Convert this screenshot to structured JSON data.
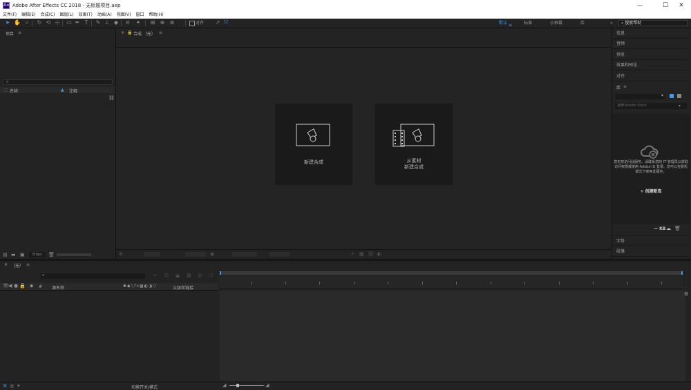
{
  "window": {
    "logo": "Ae",
    "title": "Adobe After Effects CC 2018 - 无标题项目.aep",
    "minimize": "—",
    "maximize": "☐",
    "close": "✕"
  },
  "menu": [
    "文件(F)",
    "编辑(E)",
    "合成(C)",
    "图层(L)",
    "效果(T)",
    "动画(A)",
    "视图(V)",
    "窗口",
    "帮助(H)"
  ],
  "toolbar": {
    "align_checkbox_label": "对齐",
    "workspaces": [
      "默认",
      "标准",
      "小屏幕",
      "库"
    ],
    "workspace_more": "»",
    "search_help": "搜索帮助"
  },
  "project_panel": {
    "title": "项目",
    "menu_icon": "≡",
    "search_icon": "search-icon",
    "col_name": "名称",
    "col_comment": "注释",
    "bpc": "8 bpc"
  },
  "composition_panel": {
    "close_x": "×",
    "tab_label": "合成 （无）",
    "menu_icon": "≡",
    "new_comp_label": "新建合成",
    "from_footage_line1": "从素材",
    "from_footage_line2": "新建合成"
  },
  "right_panels": {
    "items": [
      "信息",
      "音频",
      "预览",
      "效果和预设",
      "对齐"
    ],
    "library": {
      "title": "库",
      "menu_icon": "≡",
      "search_placeholder": "搜索 Adobe Stock",
      "message": "您无权访问此服务。请联系您的 IT 管理员以获取访问权限或使用 Adobe ID 登录。您可以在脱机模式下使用此服务。",
      "create_button": "+ 创建新库",
      "kb_label": "— KB"
    },
    "bottom_items": [
      "字符",
      "段落"
    ]
  },
  "timeline_panel": {
    "close_x": "×",
    "tab_label": "（无）",
    "menu_icon": "≡",
    "col_number": "#",
    "col_source": "源名称",
    "col_parent": "父级和链接",
    "toggle_label": "切换开关/模式"
  },
  "colors": {
    "accent": "#3d9cf0",
    "panel_bg": "#232323",
    "dark_bg": "#1d1d1d",
    "titlebar_bg": "#ffffff"
  }
}
